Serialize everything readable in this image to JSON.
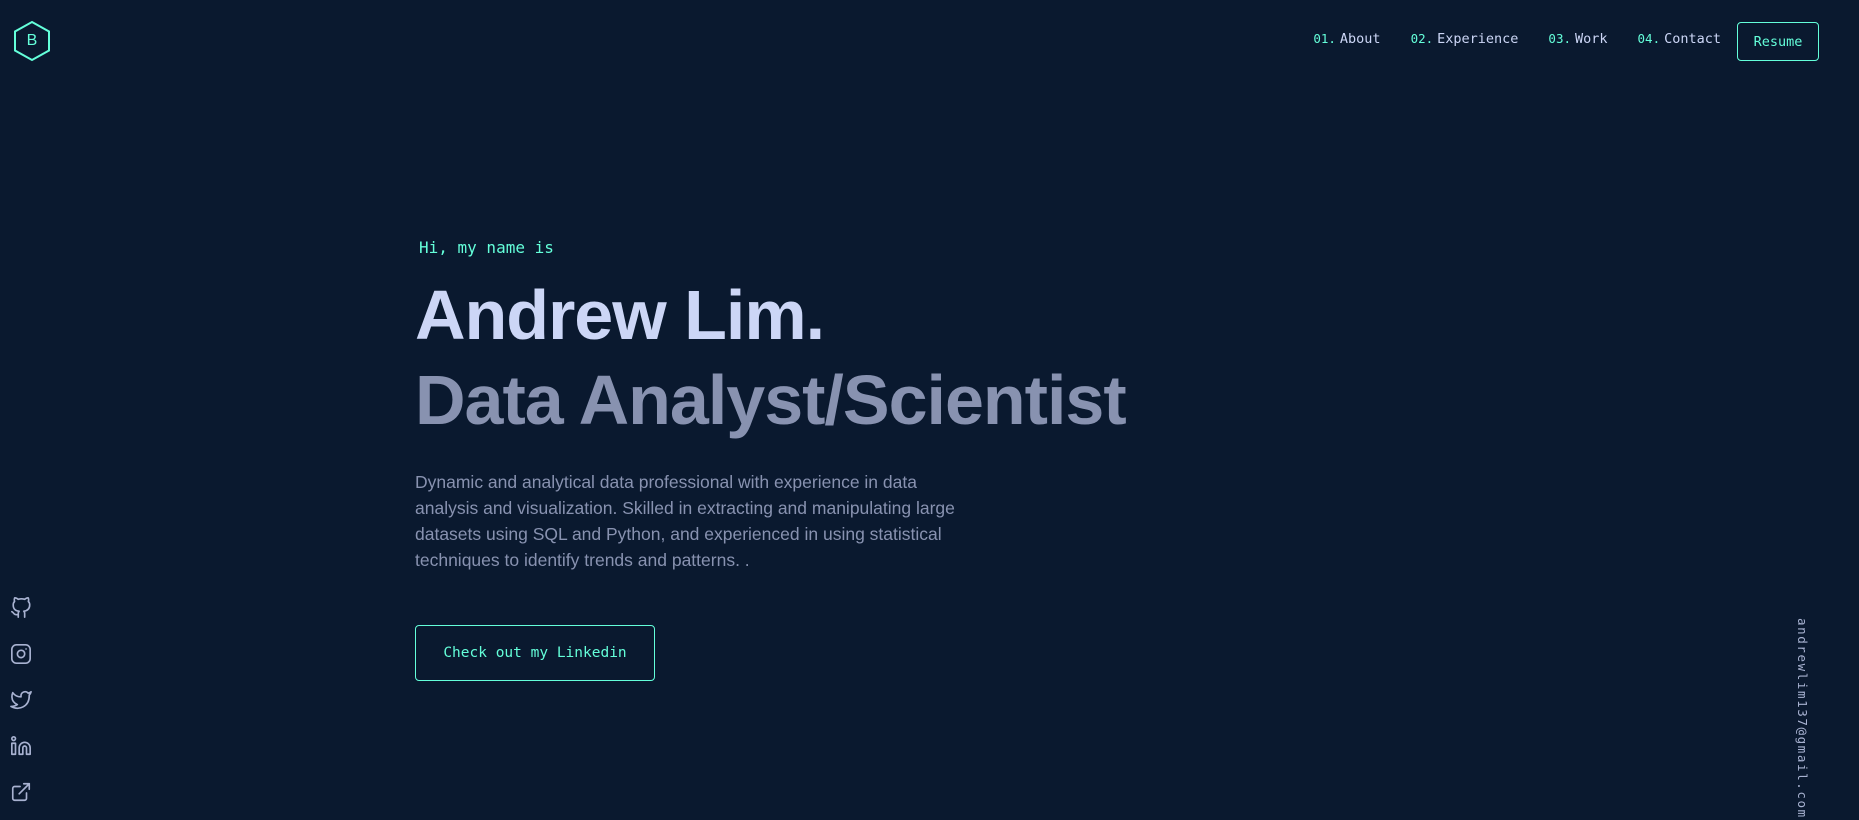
{
  "logo": {
    "letter": "B",
    "icon": "hexagon-logo-icon"
  },
  "nav": {
    "items": [
      {
        "num": "01.",
        "label": "About"
      },
      {
        "num": "02.",
        "label": "Experience"
      },
      {
        "num": "03.",
        "label": "Work"
      },
      {
        "num": "04.",
        "label": "Contact"
      }
    ],
    "resume_label": "Resume"
  },
  "hero": {
    "greeting": "Hi, my name is",
    "name": "Andrew Lim.",
    "role": "Data Analyst/Scientist",
    "bio": "Dynamic and analytical data professional with experience in data analysis and visualization. Skilled in extracting and manipulating large datasets using SQL and Python, and experienced in using statistical techniques to identify trends and patterns. .",
    "cta_label": "Check out my Linkedin"
  },
  "social": [
    "github-icon",
    "instagram-icon",
    "twitter-icon",
    "linkedin-icon",
    "external-link-icon"
  ],
  "email": "andrewlim137@gmail.com",
  "colors": {
    "background": "#0a192f",
    "accent": "#64ffda",
    "heading": "#ccd6f6",
    "text": "#8892b0"
  }
}
